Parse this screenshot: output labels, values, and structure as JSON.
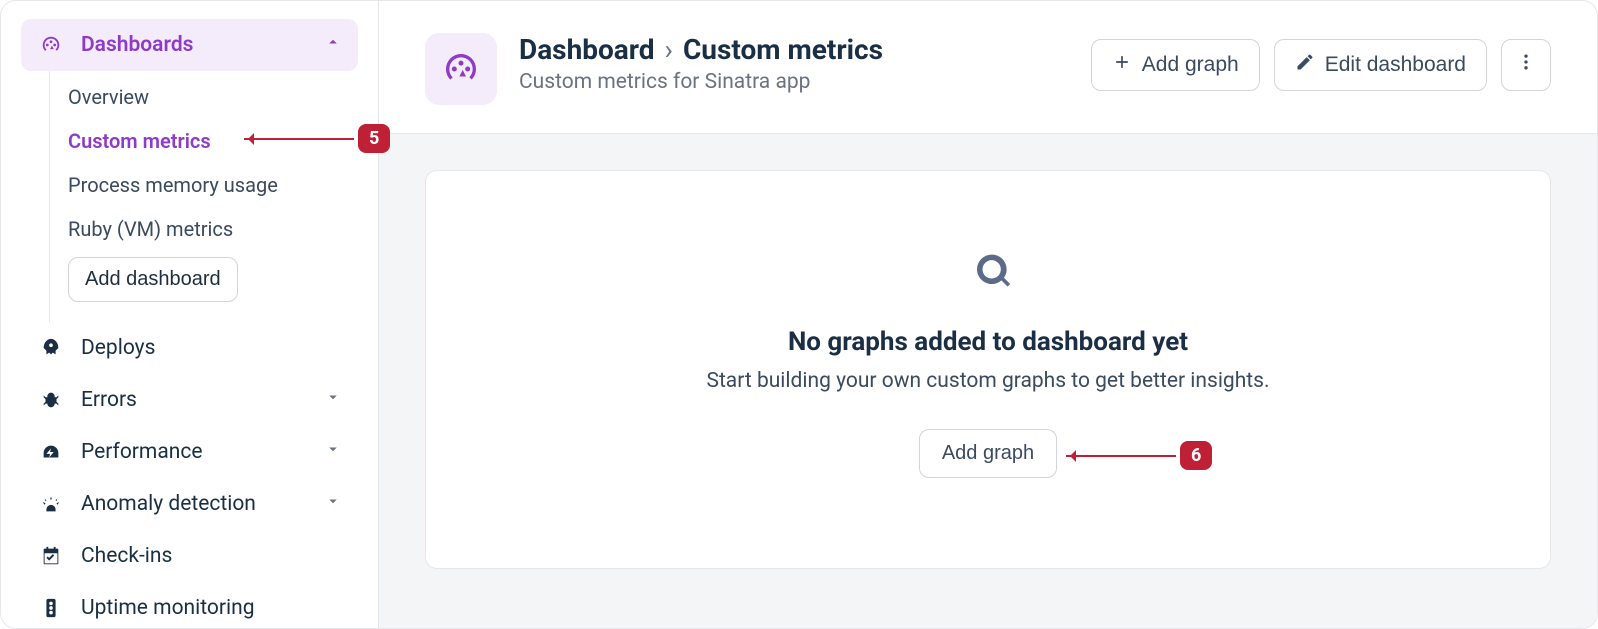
{
  "sidebar": {
    "dashboards": {
      "label": "Dashboards",
      "items": [
        "Overview",
        "Custom metrics",
        "Process memory usage",
        "Ruby (VM) metrics"
      ],
      "selected_index": 1,
      "add_button": "Add dashboard"
    },
    "nav": [
      {
        "label": "Deploys",
        "icon": "rocket",
        "expandable": false
      },
      {
        "label": "Errors",
        "icon": "bug",
        "expandable": true
      },
      {
        "label": "Performance",
        "icon": "gauge",
        "expandable": true
      },
      {
        "label": "Anomaly detection",
        "icon": "siren",
        "expandable": true
      },
      {
        "label": "Check-ins",
        "icon": "calendar-check",
        "expandable": false
      },
      {
        "label": "Uptime monitoring",
        "icon": "traffic-light",
        "expandable": false
      }
    ]
  },
  "header": {
    "breadcrumb_root": "Dashboard",
    "breadcrumb_current": "Custom metrics",
    "subtitle": "Custom metrics for Sinatra app",
    "actions": {
      "add_graph": "Add graph",
      "edit_dashboard": "Edit dashboard"
    }
  },
  "empty_state": {
    "title": "No graphs added to dashboard yet",
    "subtitle": "Start building your own custom graphs to get better insights.",
    "button": "Add graph"
  },
  "annotations": {
    "a5": "5",
    "a6": "6"
  }
}
